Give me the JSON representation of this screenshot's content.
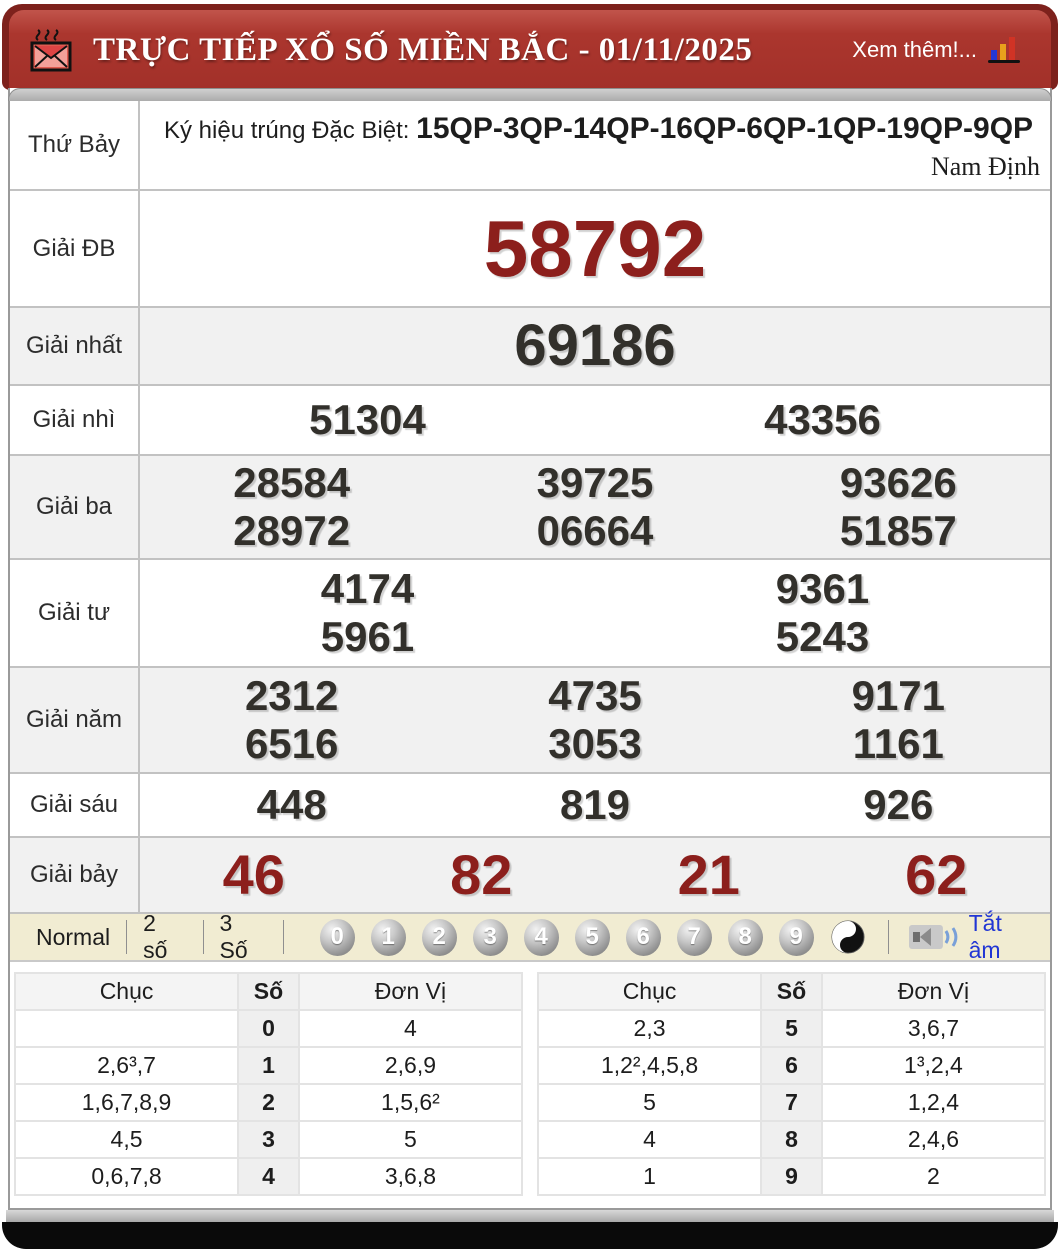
{
  "header": {
    "title": "TRỰC TIẾP XỔ SỐ MIỀN BẮC - 01/11/2025",
    "more_label": "Xem thêm!...",
    "envelope_icon": "hot-envelope-icon",
    "chart_icon": "bar-chart-icon",
    "colors": {
      "bar": "#a23029",
      "frame": "#7d211c",
      "text": "#ffffff"
    }
  },
  "results": {
    "day_label": "Thứ Bảy",
    "symbol_prefix": "Ký hiệu trúng Đặc Biệt:",
    "symbol_code": "15QP-3QP-14QP-16QP-6QP-1QP-19QP-9QP",
    "province": "Nam Định",
    "special_color": "#8c1f1c",
    "rows": {
      "db": {
        "label": "Giải ĐB",
        "numbers": [
          "58792"
        ]
      },
      "g1": {
        "label": "Giải nhất",
        "numbers": [
          "69186"
        ]
      },
      "g2": {
        "label": "Giải nhì",
        "numbers": [
          "51304",
          "43356"
        ]
      },
      "g3": {
        "label": "Giải ba",
        "line1": [
          "28584",
          "39725",
          "93626"
        ],
        "line2": [
          "28972",
          "06664",
          "51857"
        ]
      },
      "g4": {
        "label": "Giải tư",
        "line1": [
          "4174",
          "9361"
        ],
        "line2": [
          "5961",
          "5243"
        ]
      },
      "g5": {
        "label": "Giải năm",
        "line1": [
          "2312",
          "4735",
          "9171"
        ],
        "line2": [
          "6516",
          "3053",
          "1161"
        ]
      },
      "g6": {
        "label": "Giải sáu",
        "numbers": [
          "448",
          "819",
          "926"
        ]
      },
      "g7": {
        "label": "Giải bảy",
        "numbers": [
          "46",
          "82",
          "21",
          "62"
        ]
      }
    }
  },
  "toolbar": {
    "modes": [
      "Normal",
      "2 số",
      "3 Số"
    ],
    "balls": [
      "0",
      "1",
      "2",
      "3",
      "4",
      "5",
      "6",
      "7",
      "8",
      "9"
    ],
    "yinyang_icon": "yin-yang-ball",
    "speaker_icon": "speaker-icon",
    "mute_label": "Tắt âm",
    "mute_color": "#2136d4",
    "background": "#f1ecd2"
  },
  "stats": {
    "left": {
      "headers": {
        "chuc": "Chục",
        "so": "Số",
        "donvi": "Đơn Vị"
      },
      "rows": [
        {
          "chuc": "",
          "so": "0",
          "donvi": "4"
        },
        {
          "chuc": "2,6³,7",
          "so": "1",
          "donvi": "2,6,9"
        },
        {
          "chuc": "1,6,7,8,9",
          "so": "2",
          "donvi": "1,5,6²"
        },
        {
          "chuc": "4,5",
          "so": "3",
          "donvi": "5"
        },
        {
          "chuc": "0,6,7,8",
          "so": "4",
          "donvi": "3,6,8"
        }
      ]
    },
    "right": {
      "headers": {
        "chuc": "Chục",
        "so": "Số",
        "donvi": "Đơn Vị"
      },
      "rows": [
        {
          "chuc": "2,3",
          "so": "5",
          "donvi": "3,6,7"
        },
        {
          "chuc": "1,2²,4,5,8",
          "so": "6",
          "donvi": "1³,2,4"
        },
        {
          "chuc": "5",
          "so": "7",
          "donvi": "1,2,4"
        },
        {
          "chuc": "4",
          "so": "8",
          "donvi": "2,4,6"
        },
        {
          "chuc": "1",
          "so": "9",
          "donvi": "2"
        }
      ]
    }
  }
}
